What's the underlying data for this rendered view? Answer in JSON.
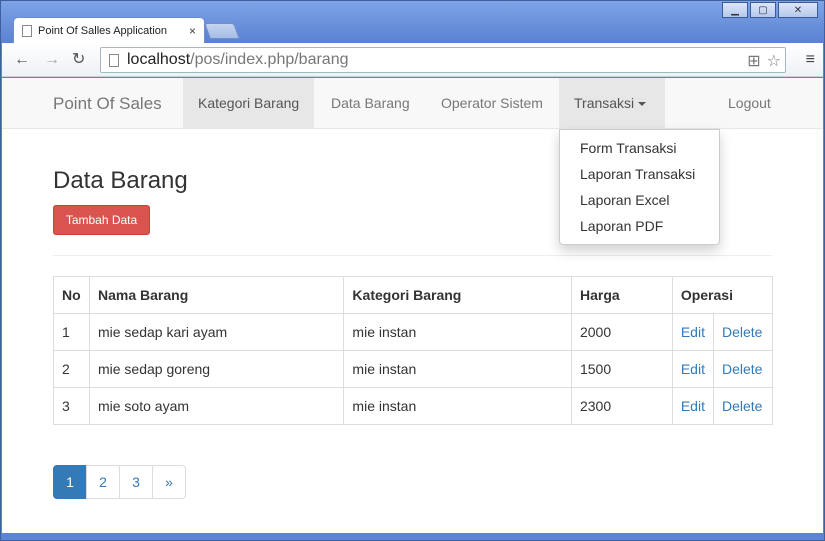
{
  "browser": {
    "tab_title": "Point Of Salles Application",
    "tab_close": "×",
    "url_host": "localhost",
    "url_path": "/pos/index.php/barang",
    "minimize": "▁",
    "maximize": "▢",
    "close": "✕",
    "back": "←",
    "forward": "→",
    "reload": "↻",
    "translate_icon": "⊞",
    "star_icon": "☆",
    "menu_icon": "≡"
  },
  "navbar": {
    "brand": "Point Of Sales",
    "items": [
      {
        "label": "Kategori Barang"
      },
      {
        "label": "Data Barang"
      },
      {
        "label": "Operator Sistem"
      },
      {
        "label": "Transaksi"
      }
    ],
    "logout": "Logout"
  },
  "dropdown": {
    "items": [
      {
        "label": "Form Transaksi"
      },
      {
        "label": "Laporan Transaksi"
      },
      {
        "label": "Laporan Excel"
      },
      {
        "label": "Laporan PDF"
      }
    ]
  },
  "page": {
    "title": "Data Barang",
    "add_button": "Tambah Data"
  },
  "table": {
    "headers": [
      "No",
      "Nama Barang",
      "Kategori Barang",
      "Harga",
      "Operasi"
    ],
    "rows": [
      {
        "no": "1",
        "nama": "mie sedap kari ayam",
        "kategori": "mie instan",
        "harga": "2000",
        "edit": "Edit",
        "delete": "Delete"
      },
      {
        "no": "2",
        "nama": "mie sedap goreng",
        "kategori": "mie instan",
        "harga": "1500",
        "edit": "Edit",
        "delete": "Delete"
      },
      {
        "no": "3",
        "nama": "mie soto ayam",
        "kategori": "mie instan",
        "harga": "2300",
        "edit": "Edit",
        "delete": "Delete"
      }
    ]
  },
  "pagination": {
    "pages": [
      "1",
      "2",
      "3",
      "»"
    ],
    "active": "1"
  },
  "colors": {
    "danger": "#d9534f",
    "primary": "#337ab7"
  }
}
